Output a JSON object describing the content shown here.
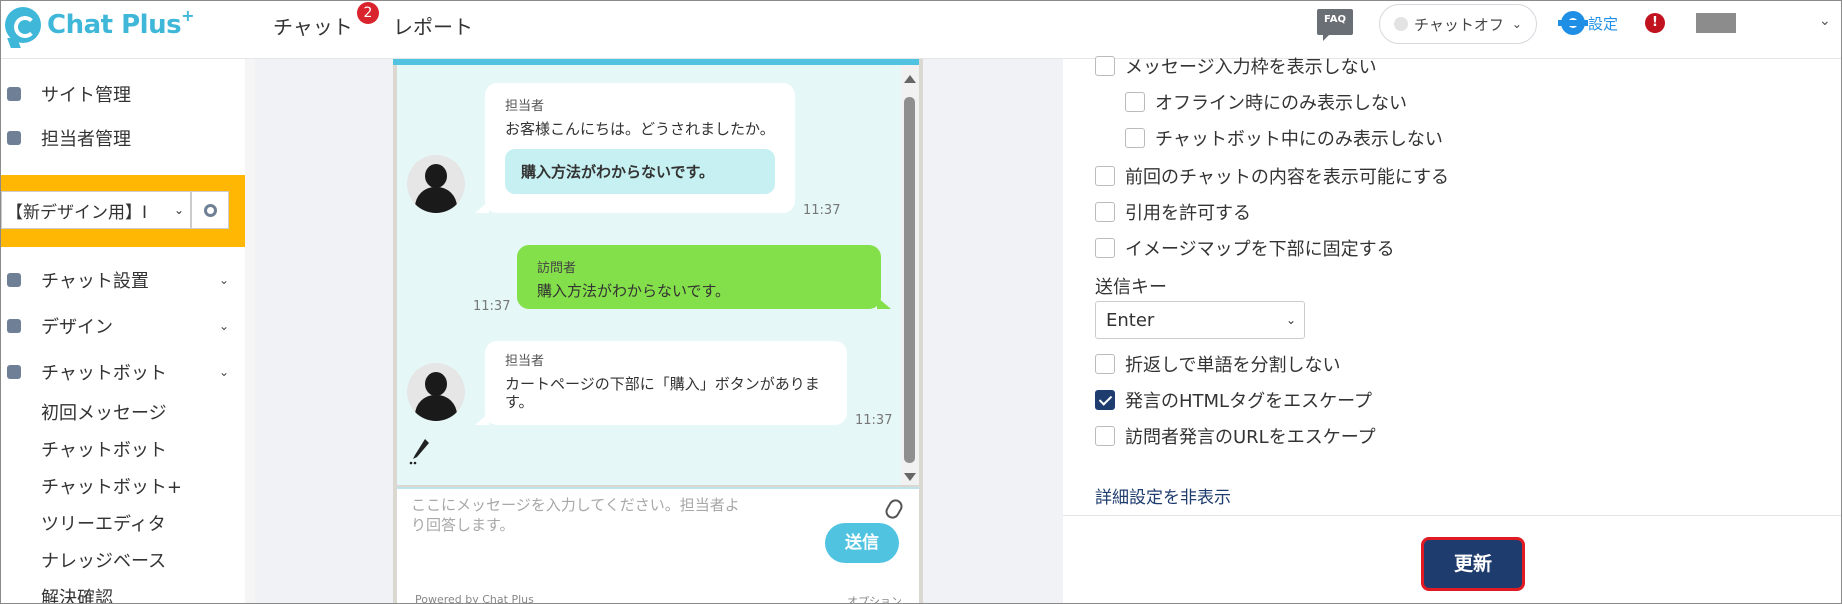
{
  "app": {
    "brand": "Chat Plus",
    "brand_sup": "+",
    "accent_color": "#3eb7d9"
  },
  "header": {
    "nav_chat": "チャット",
    "nav_chat_badge": "2",
    "nav_report": "レポート",
    "faq": "FAQ",
    "status_label": "チャットオフ",
    "settings_label": "設定",
    "alert": "!"
  },
  "sidebar": {
    "items": [
      {
        "label": "サイト管理",
        "icon": "gear-icon"
      },
      {
        "label": "担当者管理",
        "icon": "users-icon"
      }
    ],
    "site_select": "【新デザイン用】I",
    "sections": [
      {
        "label": "チャット設置",
        "icon": "tools-icon"
      },
      {
        "label": "デザイン",
        "icon": "palette-icon"
      },
      {
        "label": "チャットボット",
        "icon": "chat-icon"
      }
    ],
    "subitems": [
      "初回メッセージ",
      "チャットボット",
      "チャットボット+",
      "ツリーエディタ",
      "ナレッジベース",
      "解決確認"
    ]
  },
  "chat_preview": {
    "msg1": {
      "who": "担当者",
      "text": "お客様こんにちは。どうされましたか。",
      "quick_reply": "購入方法がわからないです。",
      "time": "11:37"
    },
    "msg2": {
      "who": "訪問者",
      "text": "購入方法がわからないです。",
      "time": "11:37"
    },
    "msg3": {
      "who": "担当者",
      "text": "カートページの下部に「購入」ボタンがあります。",
      "time": "11:37"
    },
    "input_placeholder": "ここにメッセージを入力してください。担当者より回答します。",
    "send_label": "送信",
    "powered_by": "Powered by Chat Plus",
    "option": "オプション"
  },
  "settings": {
    "partial_top": "メッセージ入力枠を表示しない",
    "offline_only": "オフライン時にのみ表示しない",
    "chatbot_only": "チャットボット中にのみ表示しない",
    "show_previous": "前回のチャットの内容を表示可能にする",
    "allow_quote": "引用を許可する",
    "imagemap_fixed": "イメージマップを下部に固定する",
    "send_key_label": "送信キー",
    "send_key_value": "Enter",
    "no_word_split": "折返しで単語を分割しない",
    "escape_html": "発言のHTMLタグをエスケープ",
    "escape_html_checked": true,
    "escape_url": "訪問者発言のURLをエスケープ",
    "hide_details": "詳細設定を非表示",
    "update": "更新"
  }
}
